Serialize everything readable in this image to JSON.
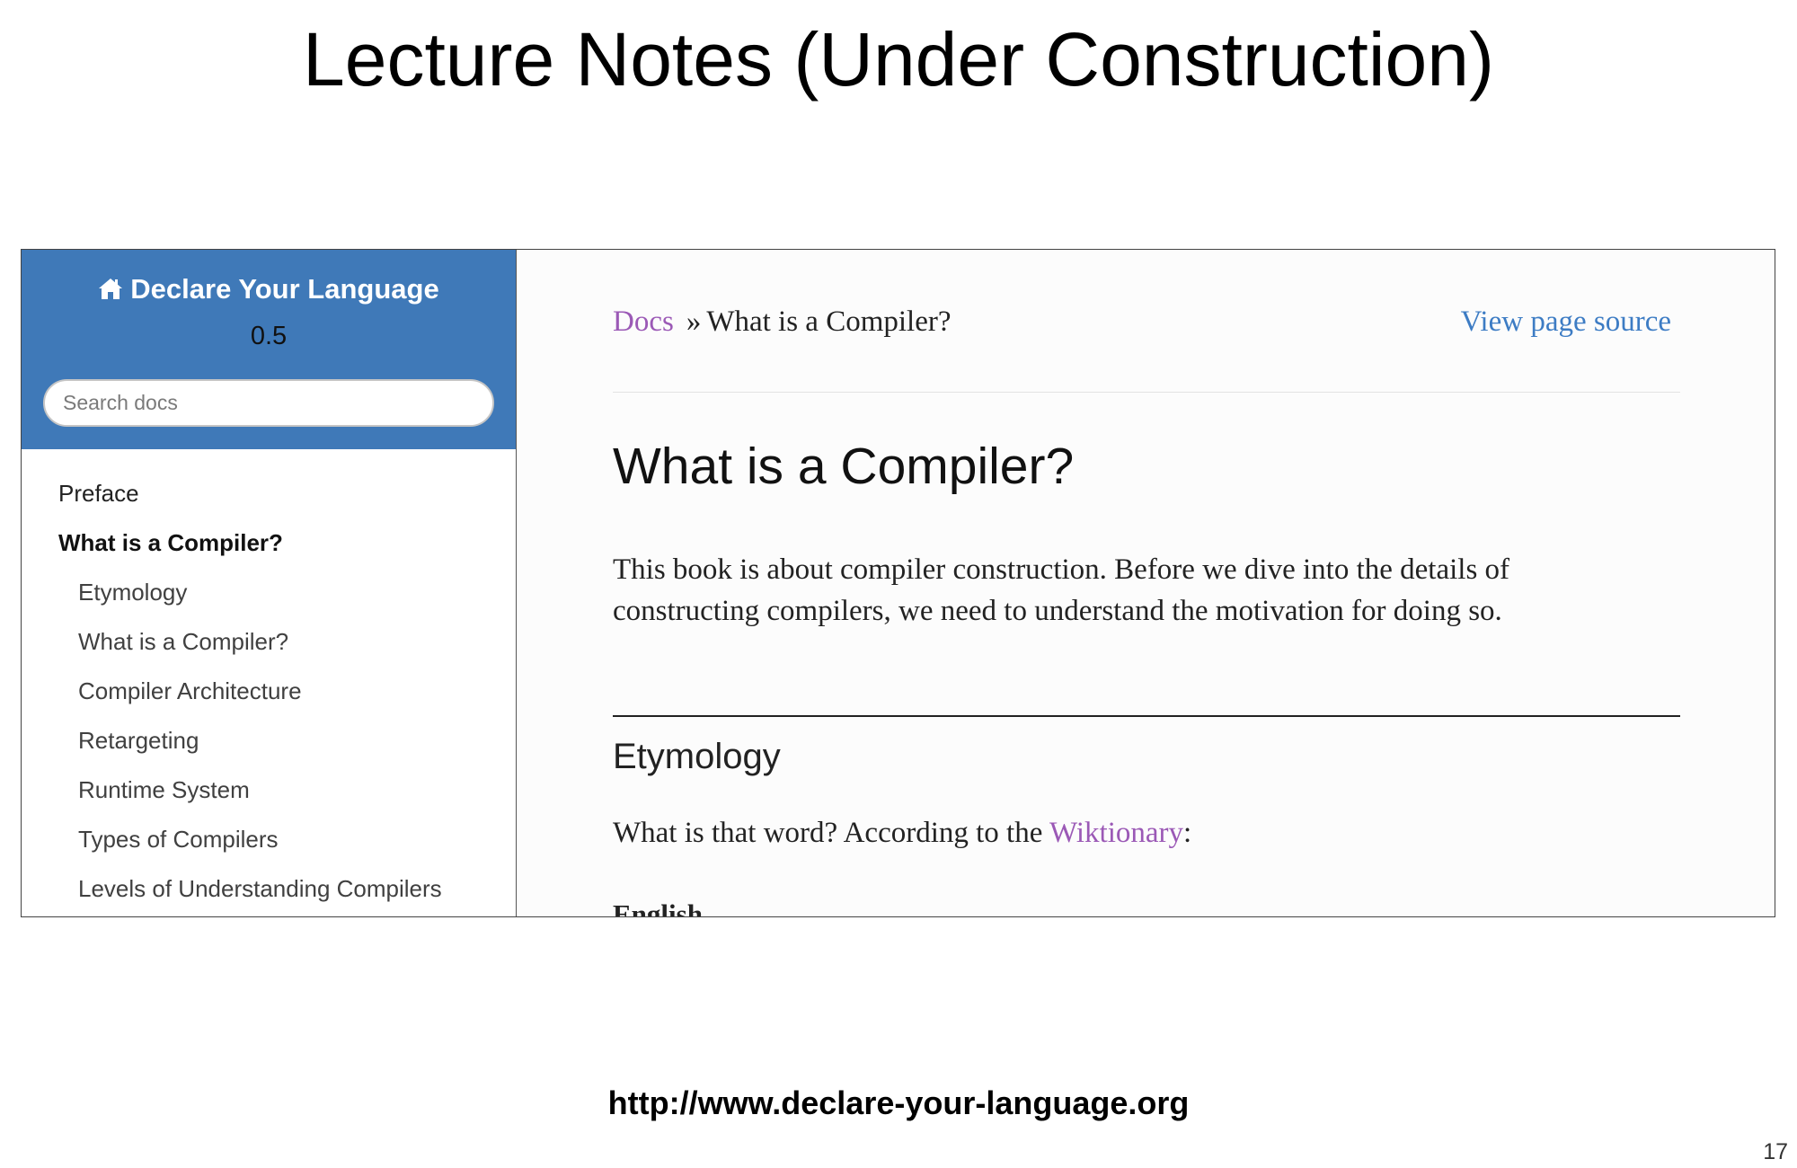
{
  "slide": {
    "title": "Lecture Notes (Under Construction)",
    "url": "http://www.declare-your-language.org",
    "page_number": "17"
  },
  "sidebar": {
    "project_name": "Declare Your Language",
    "home_icon": "home-icon",
    "version": "0.5",
    "search_placeholder": "Search docs",
    "items": [
      {
        "label": "Preface",
        "level": 1,
        "current": false
      },
      {
        "label": "What is a Compiler?",
        "level": 1,
        "current": true
      },
      {
        "label": "Etymology",
        "level": 2,
        "current": false
      },
      {
        "label": "What is a Compiler?",
        "level": 2,
        "current": false
      },
      {
        "label": "Compiler Architecture",
        "level": 2,
        "current": false
      },
      {
        "label": "Retargeting",
        "level": 2,
        "current": false
      },
      {
        "label": "Runtime System",
        "level": 2,
        "current": false
      },
      {
        "label": "Types of Compilers",
        "level": 2,
        "current": false
      },
      {
        "label": "Levels of Understanding Compilers",
        "level": 2,
        "current": false
      }
    ],
    "header_color": "#3f79b8"
  },
  "content": {
    "breadcrumb_docs": "Docs",
    "breadcrumb_sep": "»",
    "breadcrumb_current": "What is a Compiler?",
    "view_source": "View page source",
    "heading": "What is a Compiler?",
    "intro": "This book is about compiler construction. Before we dive into the details of constructing compilers, we need to understand the motivation for doing so.",
    "section_heading": "Etymology",
    "section_text_before": "What is that word? According to the ",
    "section_link": "Wiktionary",
    "section_text_after": ":",
    "subheading": "English",
    "link_color": "#9b59b6",
    "source_link_color": "#3d7cc4"
  }
}
